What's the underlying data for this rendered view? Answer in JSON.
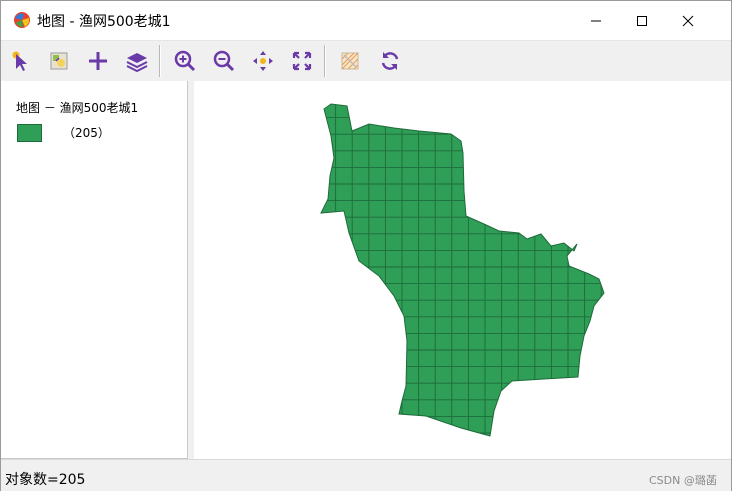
{
  "window": {
    "title": "地图 - 渔网500老城1",
    "icon": "map-globe-icon"
  },
  "toolbar": {
    "buttons": [
      {
        "name": "select-tool",
        "icon": "pointer-arrow-icon"
      },
      {
        "name": "identify-tool",
        "icon": "identify-icon"
      },
      {
        "name": "add-tool",
        "icon": "plus-icon"
      },
      {
        "name": "layers-tool",
        "icon": "layers-icon"
      },
      {
        "name": "zoom-in-tool",
        "icon": "zoom-in-icon"
      },
      {
        "name": "zoom-out-tool",
        "icon": "zoom-out-icon"
      },
      {
        "name": "pan-tool",
        "icon": "pan-icon"
      },
      {
        "name": "full-extent-tool",
        "icon": "full-extent-icon"
      },
      {
        "name": "clear-selection-tool",
        "icon": "clear-selection-icon"
      },
      {
        "name": "refresh-tool",
        "icon": "refresh-icon"
      }
    ],
    "accent_color": "#7b2fbe"
  },
  "legend": {
    "title": "地图 － 渔网500老城1",
    "items": [
      {
        "label": "（205）",
        "color": "#2f9e57"
      }
    ]
  },
  "map": {
    "fill_color": "#2f9e57",
    "grid_color": "#1e6b3a",
    "feature_count": 205
  },
  "status": {
    "text": "对象数=205"
  },
  "watermark": "CSDN @璐菡"
}
